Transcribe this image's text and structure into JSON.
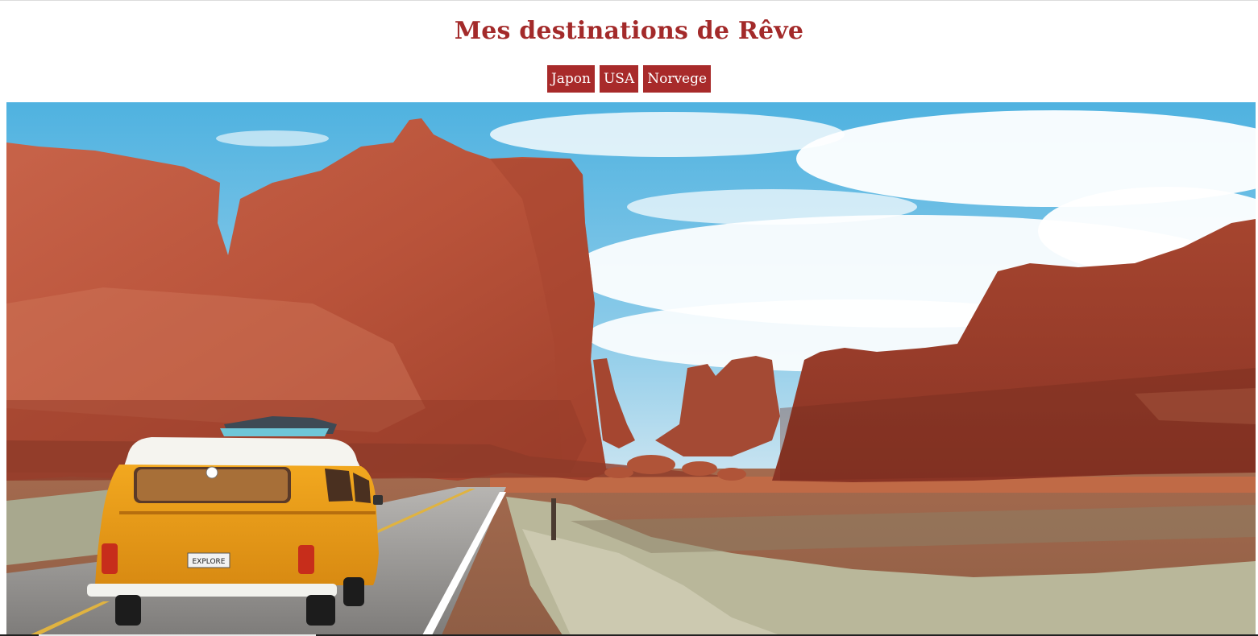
{
  "header": {
    "title": "Mes destinations de Rêve"
  },
  "nav": {
    "items": [
      {
        "label": "Japon"
      },
      {
        "label": "USA"
      },
      {
        "label": "Norvege"
      }
    ]
  },
  "hero": {
    "license_plate": "EXPLORE"
  },
  "colors": {
    "accent": "#a82a2a",
    "title": "#a32a2a",
    "sky": "#5fb8df",
    "rock": "#b8533a",
    "van": "#f0a020"
  }
}
